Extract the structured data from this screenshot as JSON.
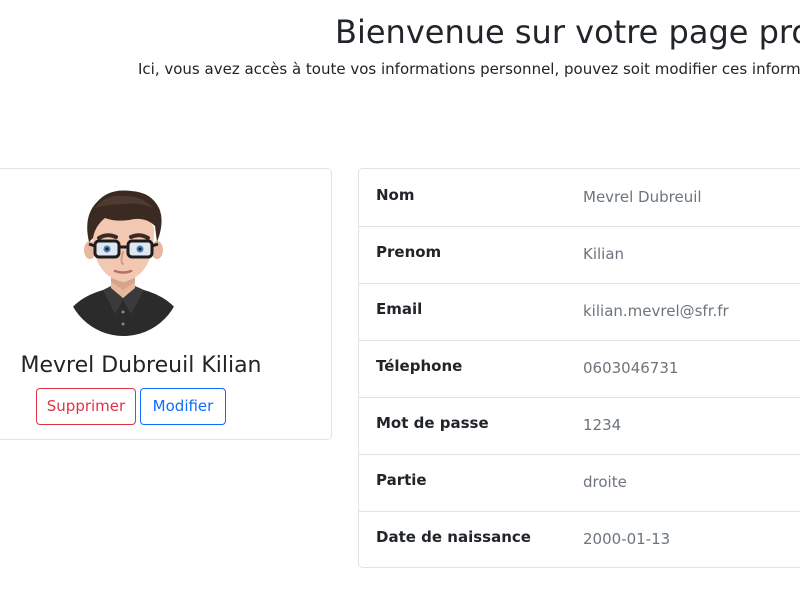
{
  "header": {
    "title": "Bienvenue sur votre page profil",
    "subtitle": "Ici, vous avez accès à toute vos informations personnel, pouvez soit modifier ces informations,"
  },
  "profile": {
    "name": "Mevrel Dubreuil Kilian",
    "avatar_icon": "user-avatar-icon",
    "delete_label": "Supprimer",
    "edit_label": "Modifier"
  },
  "details": [
    {
      "label": "Nom",
      "value": "Mevrel Dubreuil"
    },
    {
      "label": "Prenom",
      "value": "Kilian"
    },
    {
      "label": "Email",
      "value": "kilian.mevrel@sfr.fr"
    },
    {
      "label": "Télephone",
      "value": "0603046731"
    },
    {
      "label": "Mot de passe",
      "value": "1234"
    },
    {
      "label": "Partie",
      "value": "droite"
    },
    {
      "label": "Date de naissance",
      "value": "2000-01-13"
    }
  ],
  "colors": {
    "delete": "#dc3545",
    "edit": "#0d6efd",
    "border": "#dfe2e6",
    "value_text": "#6c757d"
  }
}
